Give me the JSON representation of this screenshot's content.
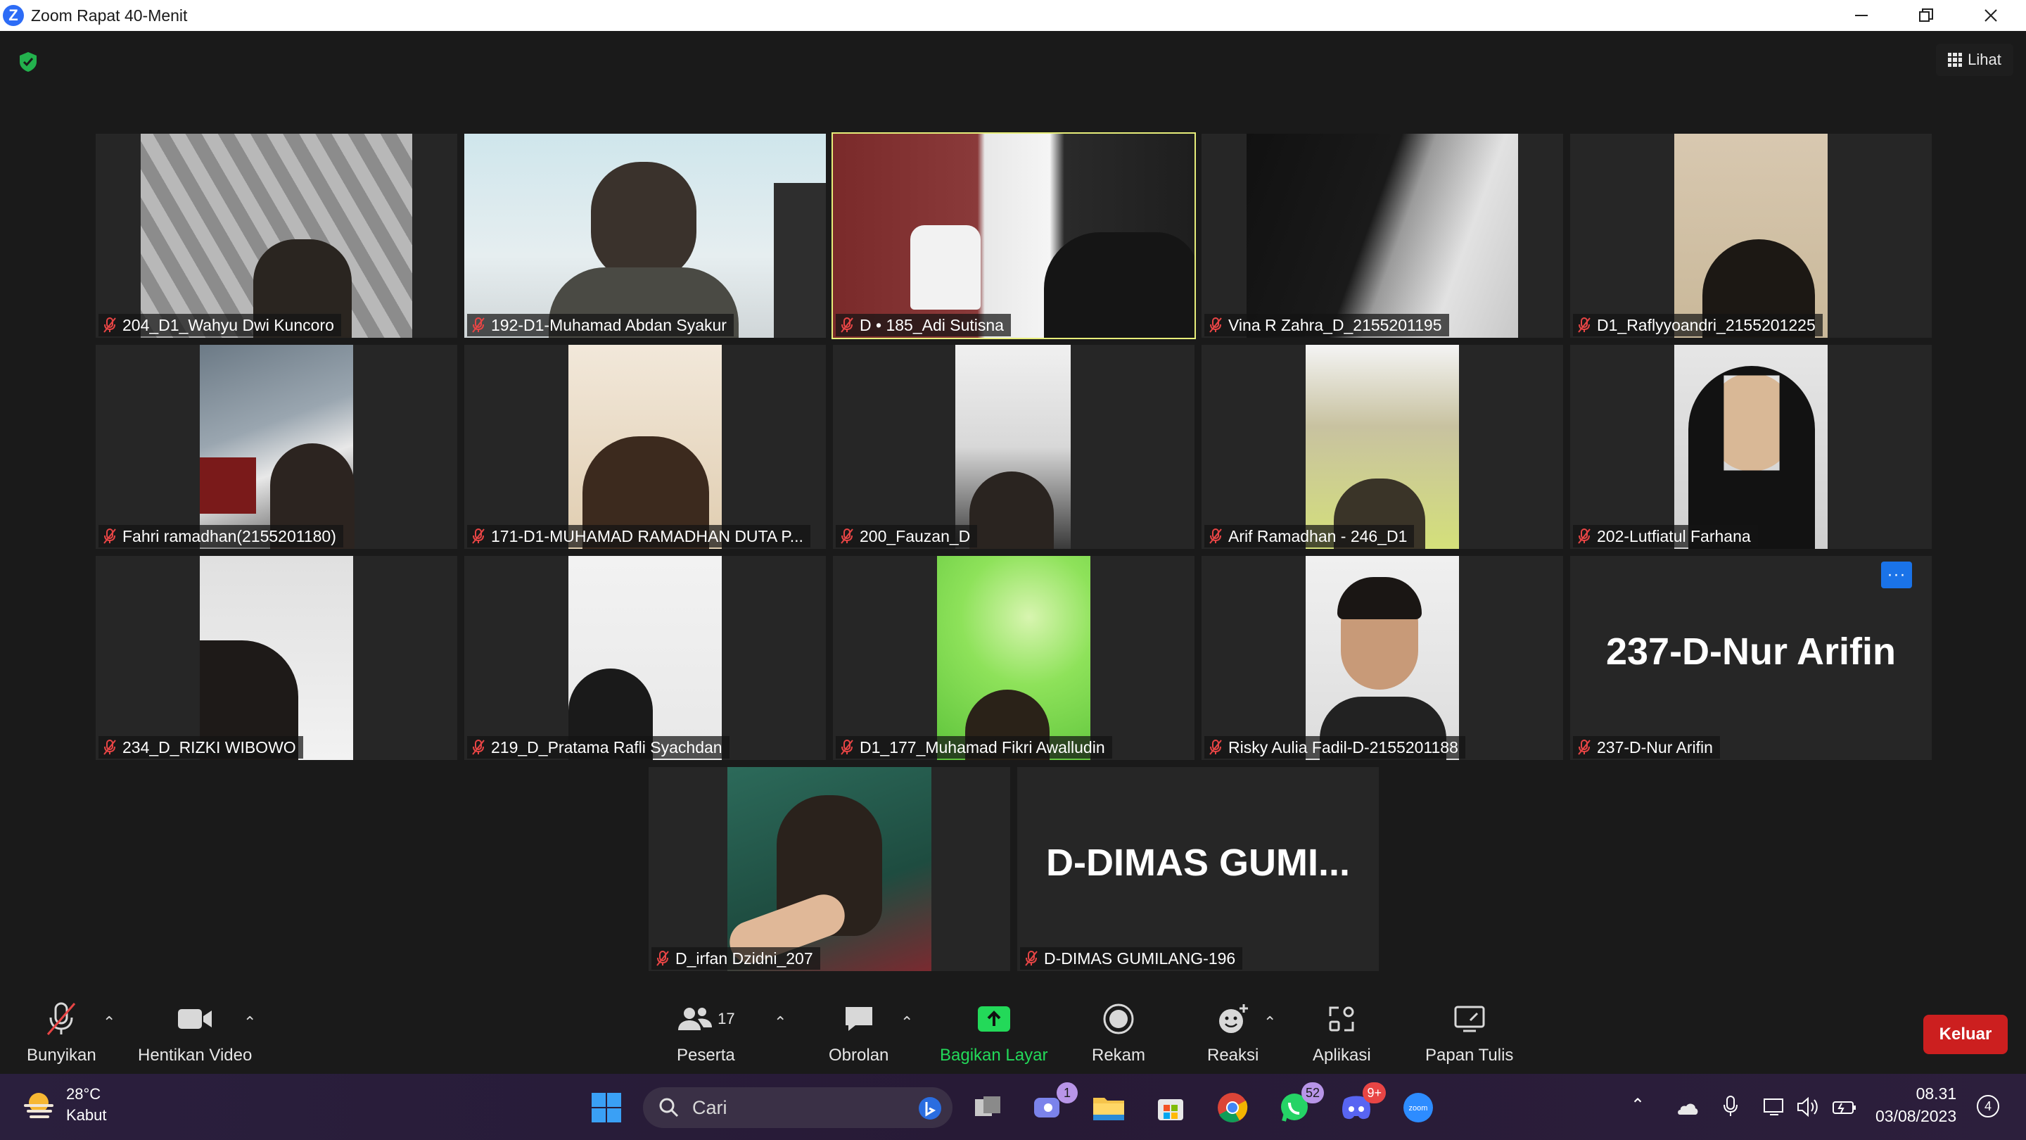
{
  "window": {
    "title": "Zoom Rapat 40-Menit"
  },
  "header": {
    "view_label": "Lihat"
  },
  "participants": [
    {
      "name": "204_D1_Wahyu Dwi Kuncoro",
      "muted": true,
      "video": true
    },
    {
      "name": "192-D1-Muhamad Abdan Syakur",
      "muted": true,
      "video": true
    },
    {
      "name": "D • 185_Adi Sutisna",
      "muted": true,
      "video": true,
      "active_speaker": true
    },
    {
      "name": "Vina R Zahra_D_2155201195",
      "muted": true,
      "video": true
    },
    {
      "name": "D1_Raflyyoandri_2155201225",
      "muted": true,
      "video": true
    },
    {
      "name": "Fahri ramadhan(2155201180)",
      "muted": true,
      "video": true
    },
    {
      "name": "171-D1-MUHAMAD RAMADHAN DUTA P...",
      "muted": true,
      "video": true
    },
    {
      "name": "200_Fauzan_D",
      "muted": true,
      "video": true
    },
    {
      "name": "Arif Ramadhan - 246_D1",
      "muted": true,
      "video": true
    },
    {
      "name": "202-Lutfiatul Farhana",
      "muted": true,
      "video": true
    },
    {
      "name": "234_D_RIZKI WIBOWO",
      "muted": true,
      "video": true
    },
    {
      "name": "219_D_Pratama Rafli Syachdan",
      "muted": true,
      "video": true
    },
    {
      "name": "D1_177_Muhamad Fikri Awalludin",
      "muted": true,
      "video": true
    },
    {
      "name": "Risky Aulia Fadil-D-2155201188",
      "muted": true,
      "video": true
    },
    {
      "name": "237-D-Nur Arifin",
      "muted": true,
      "video": false,
      "display_name": "237-D-Nur Arifin"
    },
    {
      "name": "D_irfan Dzidni_207",
      "muted": true,
      "video": true
    },
    {
      "name": "D-DIMAS GUMILANG-196",
      "muted": true,
      "video": false,
      "display_name": "D-DIMAS  GUMI..."
    }
  ],
  "tile_more_label": "···",
  "toolbar": {
    "mute_label": "Bunyikan",
    "video_label": "Hentikan Video",
    "participants_label": "Peserta",
    "participants_count": "17",
    "chat_label": "Obrolan",
    "share_label": "Bagikan Layar",
    "record_label": "Rekam",
    "reactions_label": "Reaksi",
    "apps_label": "Aplikasi",
    "whiteboard_label": "Papan Tulis",
    "leave_label": "Keluar",
    "share_color": "#23d959",
    "leave_color": "#cc1f1f"
  },
  "taskbar": {
    "weather_temp": "28°C",
    "weather_desc": "Kabut",
    "search_placeholder": "Cari",
    "teams_badge": "1",
    "whatsapp_badge": "52",
    "discord_badge": "9+",
    "time": "08.31",
    "date": "03/08/2023",
    "notification_count": "4"
  }
}
